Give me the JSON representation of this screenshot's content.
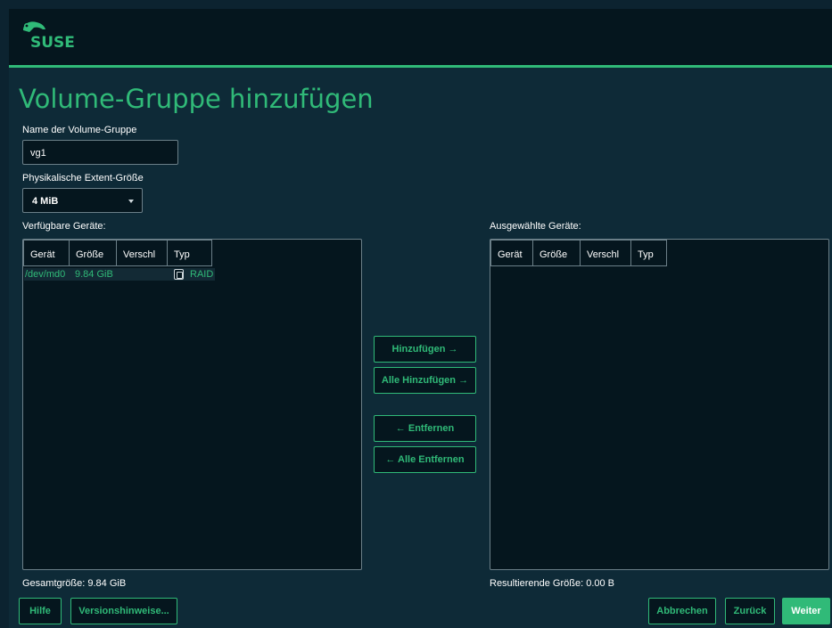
{
  "brand": {
    "logo_text": "SUSE",
    "accent_color": "#30ba78"
  },
  "page_title": "Volume-Gruppe hinzufügen",
  "vg_name": {
    "label": "Name der Volume-Gruppe",
    "value": "vg1"
  },
  "extent_size": {
    "label": "Physikalische Extent-Größe",
    "value": "4 MiB"
  },
  "available": {
    "label": "Verfügbare Geräte:",
    "columns": [
      "Gerät",
      "Größe",
      "Verschl",
      "Typ"
    ],
    "rows": [
      {
        "device": "/dev/md0",
        "size": "9.84 GiB",
        "encrypted": "",
        "type_icon": "raid-icon",
        "type": "RAID"
      }
    ],
    "total": "Gesamtgröße: 9.84 GiB"
  },
  "selected": {
    "label": "Ausgewählte Geräte:",
    "columns": [
      "Gerät",
      "Größe",
      "Verschl",
      "Typ"
    ],
    "rows": [],
    "total": "Resultierende Größe: 0.00 B"
  },
  "actions": {
    "add": "Hinzufügen →",
    "add_all": "Alle Hinzufügen →",
    "remove": "← Entfernen",
    "remove_all": "← Alle Entfernen"
  },
  "footer": {
    "help": "Hilfe",
    "release_notes": "Versionshinweise...",
    "abort": "Abbrechen",
    "back": "Zurück",
    "next": "Weiter"
  }
}
